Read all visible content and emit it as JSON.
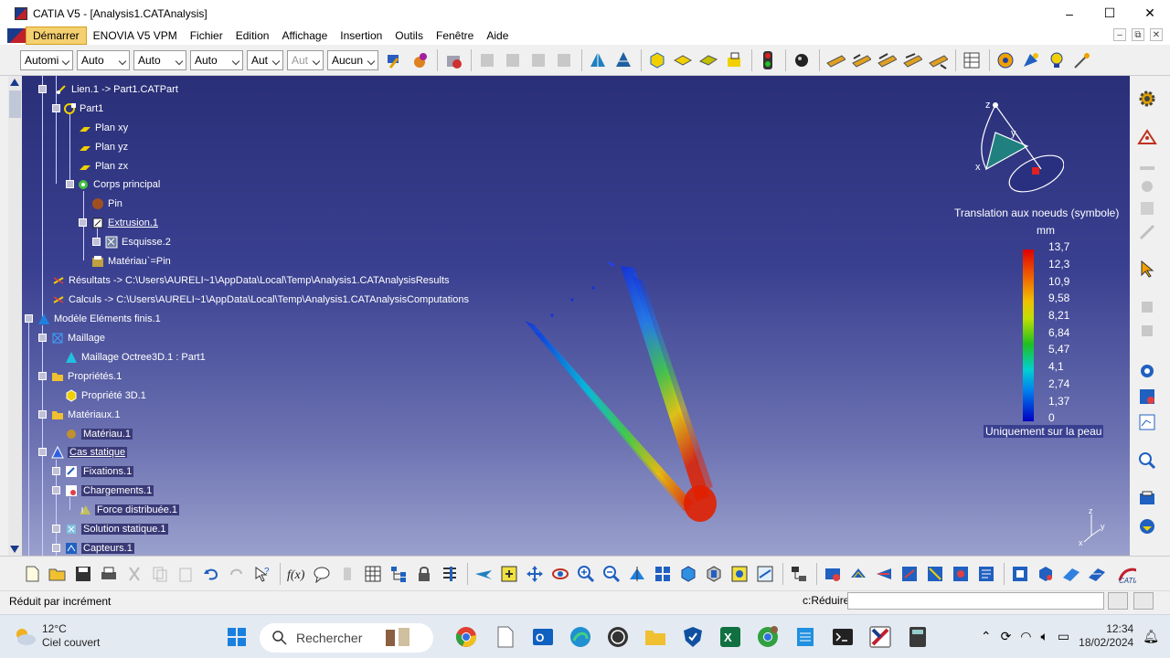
{
  "window": {
    "title": "CATIA V5 - [Analysis1.CATAnalysis]",
    "controls": [
      "–",
      "☐",
      "✕"
    ]
  },
  "menu": {
    "items": [
      "Démarrer",
      "ENOVIA V5 VPM",
      "Fichier",
      "Edition",
      "Affichage",
      "Insertion",
      "Outils",
      "Fenêtre",
      "Aide"
    ],
    "mdi_controls": [
      "–",
      "⧉",
      "✕"
    ]
  },
  "toolbar": {
    "combos": [
      {
        "value": "Automi",
        "disabled": false
      },
      {
        "value": "Auto",
        "disabled": false
      },
      {
        "value": "Auto",
        "disabled": false
      },
      {
        "value": "Auto",
        "disabled": false
      },
      {
        "value": "Aut",
        "disabled": false
      },
      {
        "value": "Aut",
        "disabled": true
      },
      {
        "value": "Aucun",
        "disabled": false
      }
    ]
  },
  "tree": {
    "nodes": [
      {
        "label": "Lien.1 -> Part1.CATPart",
        "icon": "link-icon",
        "color": "#ffffff"
      },
      {
        "label": "Part1",
        "icon": "part-icon"
      },
      {
        "label": "Plan xy",
        "icon": "plane-icon"
      },
      {
        "label": "Plan yz",
        "icon": "plane-icon"
      },
      {
        "label": "Plan zx",
        "icon": "plane-icon"
      },
      {
        "label": "Corps principal",
        "icon": "body-icon"
      },
      {
        "label": "Pin",
        "icon": "pin-icon"
      },
      {
        "label": "Extrusion.1",
        "icon": "extrusion-icon"
      },
      {
        "label": "Esquisse.2",
        "icon": "sketch-icon"
      },
      {
        "label": "Matériau`=Pin",
        "icon": "material-icon"
      },
      {
        "label": "Résultats -> C:\\Users\\AURELI~1\\AppData\\Local\\Temp\\Analysis1.CATAnalysisResults",
        "icon": "results-icon"
      },
      {
        "label": "Calculs -> C:\\Users\\AURELI~1\\AppData\\Local\\Temp\\Analysis1.CATAnalysisComputations",
        "icon": "computations-icon"
      },
      {
        "label": "Modèle Eléments finis.1",
        "icon": "fem-model-icon"
      },
      {
        "label": "Maillage",
        "icon": "mesh-icon"
      },
      {
        "label": "Maillage Octree3D.1 : Part1",
        "icon": "octree-mesh-icon"
      },
      {
        "label": "Propriétés.1",
        "icon": "folder-icon"
      },
      {
        "label": "Propriété 3D.1",
        "icon": "property-3d-icon"
      },
      {
        "label": "Matériaux.1",
        "icon": "folder-icon"
      },
      {
        "label": "Matériau.1",
        "icon": "material-ball-icon"
      },
      {
        "label": "Cas statique",
        "icon": "static-case-icon"
      },
      {
        "label": "Fixations.1",
        "icon": "restraints-icon"
      },
      {
        "label": "Chargements.1",
        "icon": "loads-icon"
      },
      {
        "label": "Force distribuée.1",
        "icon": "distributed-force-icon"
      },
      {
        "label": "Solution statique.1",
        "icon": "static-solution-icon"
      },
      {
        "label": "Capteurs.1",
        "icon": "sensors-icon"
      }
    ]
  },
  "legend": {
    "title": "Translation aux noeuds (symbole)",
    "unit": "mm",
    "values": [
      "13,7",
      "12,3",
      "10,9",
      "9,58",
      "8,21",
      "6,84",
      "5,47",
      "4,1",
      "2,74",
      "1,37",
      "0"
    ],
    "footer": "Uniquement sur la peau"
  },
  "compass": {
    "labels": [
      "z",
      "y",
      "x"
    ]
  },
  "axis_small": {
    "labels": [
      "z",
      "y",
      "x"
    ]
  },
  "status": {
    "text": "Réduit par incrément",
    "command_label": "c:Réduire",
    "command_value": ""
  },
  "taskbar": {
    "weather_temp": "12°C",
    "weather_desc": "Ciel couvert",
    "search_placeholder": "Rechercher",
    "time": "12:34",
    "date": "18/02/2024"
  }
}
